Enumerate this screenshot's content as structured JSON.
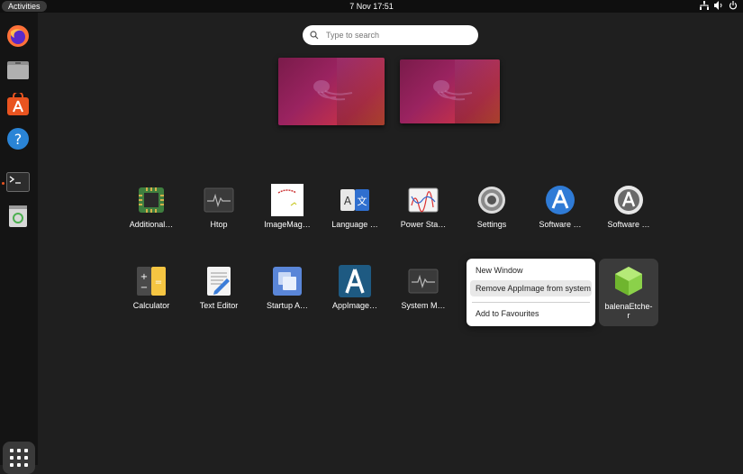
{
  "topbar": {
    "activities": "Activities",
    "clock": "7 Nov  17:51",
    "tray_icons": [
      "network-icon",
      "volume-icon",
      "power-icon"
    ]
  },
  "search": {
    "placeholder": "Type to search"
  },
  "apps_row1": [
    {
      "label": "Additional…",
      "icon": "chip-icon"
    },
    {
      "label": "Htop",
      "icon": "monitor-wave-icon"
    },
    {
      "label": "ImageMag…",
      "icon": "imagemagick-icon"
    },
    {
      "label": "Language …",
      "icon": "language-icon"
    },
    {
      "label": "Power Sta…",
      "icon": "power-stats-icon"
    },
    {
      "label": "Settings",
      "icon": "gear-icon"
    },
    {
      "label": "Software …",
      "icon": "software-updater-icon"
    },
    {
      "label": "Software …",
      "icon": "software-properties-icon"
    }
  ],
  "apps_row2": [
    {
      "label": "Calculator",
      "icon": "calculator-icon"
    },
    {
      "label": "Text Editor",
      "icon": "text-editor-icon"
    },
    {
      "label": "Startup A…",
      "icon": "startup-apps-icon"
    },
    {
      "label": "AppImage…",
      "icon": "appimagelauncher-icon"
    },
    {
      "label": "System M…",
      "icon": "system-monitor-icon"
    }
  ],
  "etcher": {
    "label_line1": "balenaEtche-",
    "label_line2": "r"
  },
  "context_menu": {
    "new_window": "New Window",
    "remove_appimage": "Remove AppImage from system",
    "add_favourites": "Add to Favourites"
  },
  "colors": {
    "accent": "#e95420",
    "panel": "#0f0f0f",
    "background": "#1f1f1f"
  }
}
